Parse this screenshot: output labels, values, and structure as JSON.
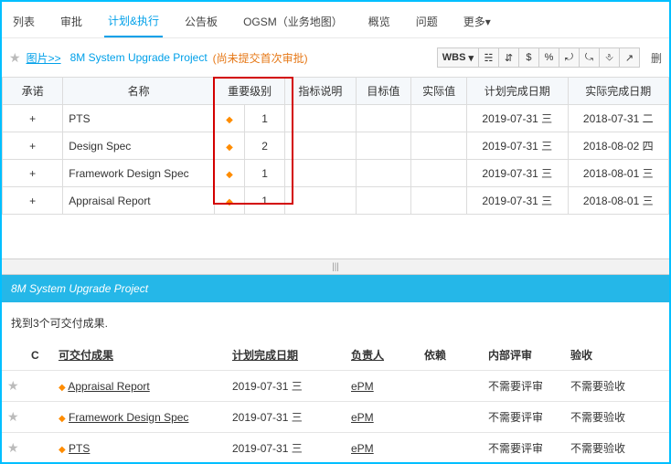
{
  "tabs": [
    "列表",
    "审批",
    "计划&执行",
    "公告板",
    "OGSM（业务地图）",
    "概览",
    "问题",
    "更多"
  ],
  "activeTab": "计划&执行",
  "header": {
    "picLink": "图片>>",
    "projectTitle": "8M System Upgrade Project",
    "pending": "(尚未提交首次审批)",
    "toolbar": {
      "wbs": "WBS",
      "icons": [
        "☵",
        "⇵",
        "$",
        "%",
        "⤾",
        "⤿",
        "⎀",
        "↗"
      ]
    },
    "trailing": "删"
  },
  "upperCols": [
    "承诺",
    "名称",
    "重要级别",
    "",
    "指标说明",
    "目标值",
    "实际值",
    "计划完成日期",
    "实际完成日期"
  ],
  "rows": [
    {
      "name": "PTS",
      "lvl": "1",
      "plan": "2019-07-31 三",
      "actual": "2018-07-31 二"
    },
    {
      "name": "Design Spec",
      "lvl": "2",
      "plan": "2019-07-31 三",
      "actual": "2018-08-02 四"
    },
    {
      "name": "Framework Design Spec",
      "lvl": "1",
      "plan": "2019-07-31 三",
      "actual": "2018-08-01 三"
    },
    {
      "name": "Appraisal Report",
      "lvl": "1",
      "plan": "2019-07-31 三",
      "actual": "2018-08-01 三"
    }
  ],
  "blueBar": "8M System Upgrade Project",
  "found": "找到3个可交付成果.",
  "lowerCols": {
    "c": "C",
    "deliv": "可交付成果",
    "plan": "计划完成日期",
    "owner": "负责人",
    "dep": "依赖",
    "review": "内部评审",
    "accept": "验收"
  },
  "lrows": [
    {
      "name": "Appraisal Report",
      "plan": "2019-07-31 三",
      "owner": "ePM",
      "review": "不需要评审",
      "accept": "不需要验收"
    },
    {
      "name": "Framework Design Spec",
      "plan": "2019-07-31 三",
      "owner": "ePM",
      "review": "不需要评审",
      "accept": "不需要验收"
    },
    {
      "name": "PTS",
      "plan": "2019-07-31 三",
      "owner": "ePM",
      "review": "不需要评审",
      "accept": "不需要验收"
    }
  ],
  "symbols": {
    "plus": "+",
    "star": "★",
    "diamond": "◆",
    "tri": "▾",
    "dots": "|||"
  }
}
